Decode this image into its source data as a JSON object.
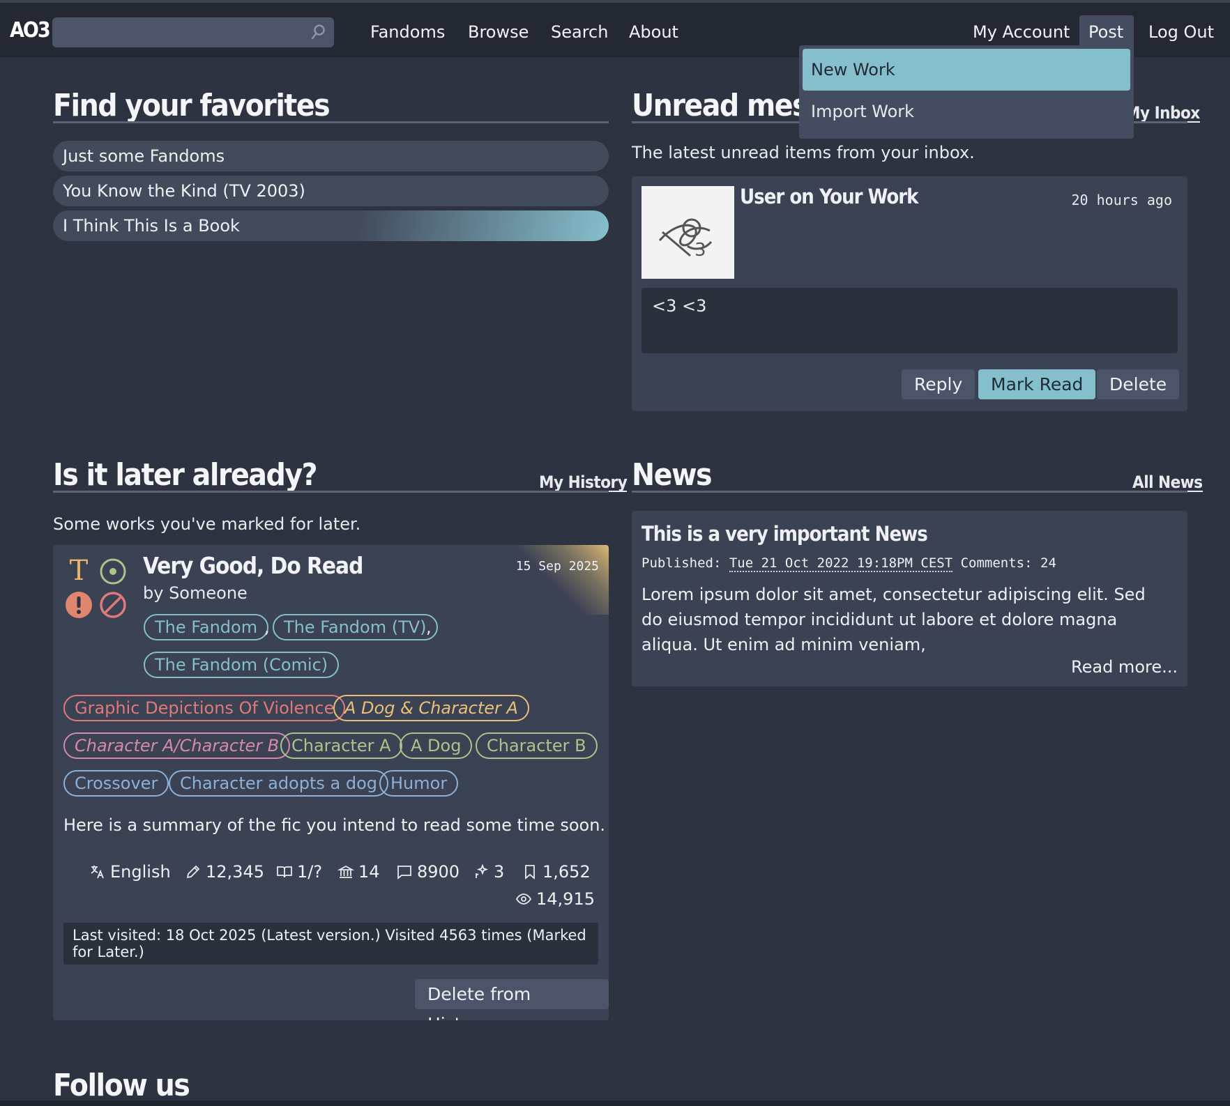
{
  "header": {
    "logo": "AO3",
    "search": {
      "value": "",
      "placeholder": ""
    },
    "nav": [
      "Fandoms",
      "Browse",
      "Search",
      "About"
    ],
    "user_nav": {
      "account": "My Account",
      "post": "Post",
      "logout": "Log Out"
    }
  },
  "post_menu": {
    "items": [
      "New Work",
      "Import Work"
    ],
    "active": "New Work"
  },
  "favorites": {
    "title": "Find your favorites",
    "items": [
      "Just some Fandoms",
      "You Know the Kind (TV 2003)",
      "I Think This Is a Book"
    ]
  },
  "inbox": {
    "title": "Unread messages",
    "link": "My Inbox",
    "intro": "The latest unread items from your inbox.",
    "message": {
      "title": "User on Your Work",
      "time": "20 hours ago",
      "body": "<3 <3",
      "actions": {
        "reply": "Reply",
        "mark_read": "Mark Read",
        "delete": "Delete"
      }
    }
  },
  "history": {
    "title": "Is it later already?",
    "link": "My History",
    "intro": "Some works you've marked for later.",
    "work": {
      "title": "Very Good, Do Read",
      "byline": "by Someone",
      "date": "15 Sep 2025",
      "fandoms": [
        "The Fandom",
        "The Fandom (TV)",
        "The Fandom (Comic)"
      ],
      "tags": {
        "warning": "Graphic Depictions Of Violence",
        "relationships": [
          "A Dog & Character A",
          "Character A/Character B"
        ],
        "characters": [
          "Character A",
          "A Dog",
          "Character B"
        ],
        "freeforms": [
          "Crossover",
          "Character adopts a dog",
          "Humor"
        ]
      },
      "summary": "Here is a summary of the fic you intend to read some time soon.",
      "stats": {
        "language": "English",
        "words": "12,345",
        "chapters": "1/?",
        "collections": "14",
        "comments": "8900",
        "kudos": "3",
        "bookmarks": "1,652",
        "hits": "14,915"
      },
      "visited": "Last visited: 18 Oct 2025 (Latest version.) Visited 4563 times (Marked for Later.)",
      "delete_label": "Delete from History"
    },
    "icons": [
      "rating-teen-icon",
      "complete-icon",
      "warning-icon",
      "no-category-icon"
    ]
  },
  "news": {
    "title": "News",
    "link": "All News",
    "post": {
      "title": "This is a very important News",
      "published_label": "Published:",
      "published": "Tue 21 Oct 2022 19:18PM CEST",
      "comments_label": "Comments:",
      "comments": "24",
      "body": "Lorem ipsum dolor sit amet, consectetur adipiscing elit. Sed do eiusmod tempor incididunt ut labore et dolore magna aliqua. Ut enim ad minim veniam,",
      "read_more": "Read more..."
    }
  },
  "follow": {
    "title": "Follow us"
  },
  "colors": {
    "background": "#2d3340",
    "card": "#3a4253",
    "accent": "#86bfcc",
    "topbar": "#232833"
  }
}
